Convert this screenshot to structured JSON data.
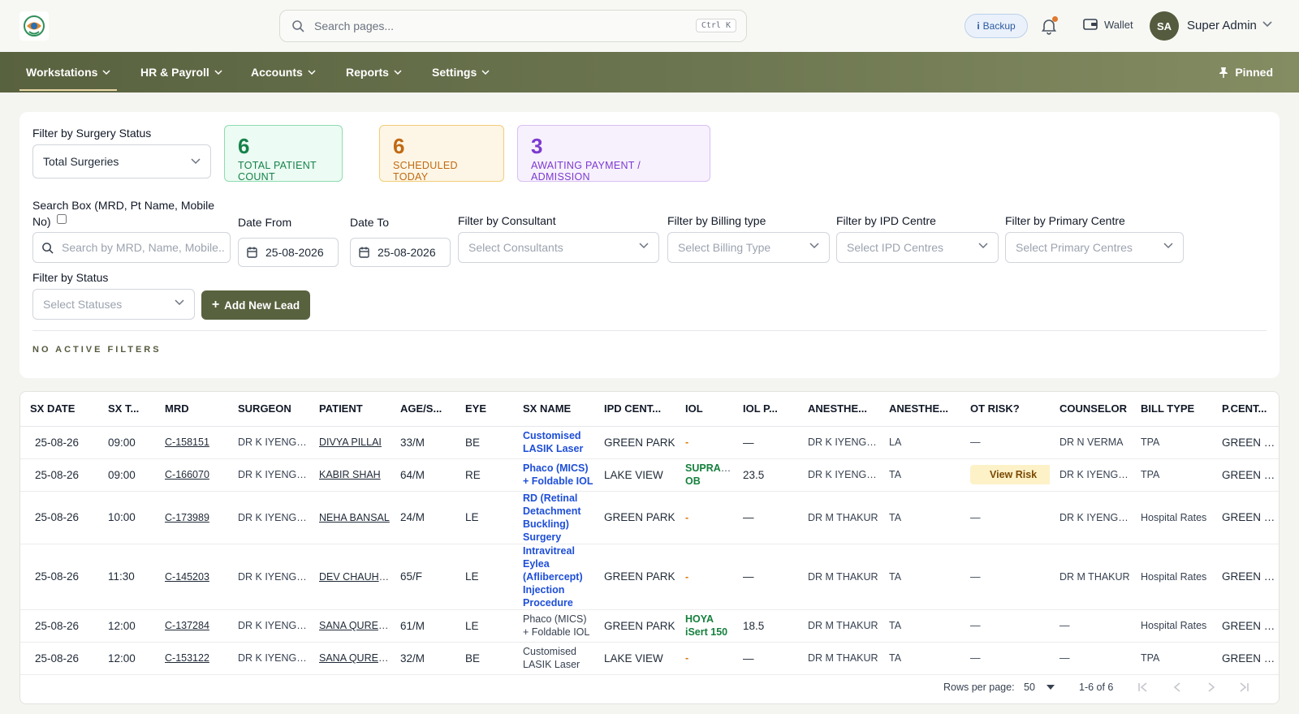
{
  "header": {
    "search_placeholder": "Search pages...",
    "search_shortcut": "Ctrl K",
    "backup_label": "Backup",
    "wallet_label": "Wallet",
    "user_initials": "SA",
    "user_name": "Super Admin"
  },
  "nav": {
    "items": [
      {
        "label": "Workstations",
        "active": true
      },
      {
        "label": "HR & Payroll"
      },
      {
        "label": "Accounts"
      },
      {
        "label": "Reports"
      },
      {
        "label": "Settings"
      }
    ],
    "pinned_label": "Pinned"
  },
  "filters": {
    "surgery_status_label": "Filter by Surgery Status",
    "surgery_status_value": "Total Surgeries",
    "stats": [
      {
        "count": "6",
        "caption": "TOTAL PATIENT COUNT"
      },
      {
        "count": "6",
        "caption": "SCHEDULED TODAY"
      },
      {
        "count": "3",
        "caption": "AWAITING PAYMENT / ADMISSION"
      }
    ],
    "search_label_line1": "Search Box (MRD, Pt Name, Mobile",
    "search_label_line2": "No)",
    "search_placeholder": "Search by MRD, Name, Mobile...",
    "date_from_label": "Date From",
    "date_from_value": "25-08-2026",
    "date_to_label": "Date To",
    "date_to_value": "25-08-2026",
    "consultant_label": "Filter by Consultant",
    "consultant_placeholder": "Select Consultants",
    "billing_label": "Filter by Billing type",
    "billing_placeholder": "Select Billing Type",
    "ipd_label": "Filter by IPD Centre",
    "ipd_placeholder": "Select IPD Centres",
    "primary_label": "Filter by Primary Centre",
    "primary_placeholder": "Select Primary Centres",
    "status_label": "Filter by Status",
    "status_placeholder": "Select Statuses",
    "add_lead_label": "Add New Lead",
    "no_active_filters": "NO ACTIVE FILTERS"
  },
  "table": {
    "columns": [
      "SX DATE",
      "SX T...",
      "MRD",
      "SURGEON",
      "PATIENT",
      "AGE/S...",
      "EYE",
      "SX NAME",
      "IPD CENT...",
      "IOL",
      "IOL P...",
      "ANESTHE...",
      "ANESTHE...",
      "OT RISK?",
      "COUNSELOR",
      "BILL TYPE",
      "P.CENT..."
    ],
    "rows": [
      {
        "date": "25-08-26",
        "time": "09:00",
        "mrd": "C-158151",
        "surgeon": "DR K IYENGAR",
        "patient": "DIVYA PILLAI",
        "age": "33/M",
        "eye": "BE",
        "sx": "Customised LASIK Laser",
        "ipd": "GREEN PARK",
        "iol": "-",
        "iolp": "—",
        "anes1": "DR K IYENGAR",
        "anes2": "LA",
        "risk": "—",
        "counselor": "DR N VERMA",
        "bill": "TPA",
        "pcent": "GREEN PA..."
      },
      {
        "date": "25-08-26",
        "time": "09:00",
        "mrd": "C-166070",
        "surgeon": "DR K IYENGAR",
        "patient": "KABIR SHAH",
        "age": "64/M",
        "eye": "RE",
        "sx": "Phaco (MICS) + Foldable IOL",
        "ipd": "LAKE VIEW",
        "iol": "SUPRAPH OB",
        "iolp": "23.5",
        "anes1": "DR K IYENGAR",
        "anes2": "TA",
        "risk": "View Risk",
        "counselor": "DR K IYENGAR",
        "bill": "TPA",
        "pcent": "GREEN PA..."
      },
      {
        "date": "25-08-26",
        "time": "10:00",
        "mrd": "C-173989",
        "surgeon": "DR K IYENGAR",
        "patient": "NEHA BANSAL",
        "age": "24/M",
        "eye": "LE",
        "sx": "RD (Retinal Detachment Buckling) Surgery",
        "ipd": "GREEN PARK",
        "iol": "-",
        "iolp": "—",
        "anes1": "DR M THAKUR",
        "anes2": "TA",
        "risk": "—",
        "counselor": "DR K IYENGAR",
        "bill": "Hospital Rates",
        "pcent": "GREEN PA..."
      },
      {
        "date": "25-08-26",
        "time": "11:30",
        "mrd": "C-145203",
        "surgeon": "DR K IYENGAR",
        "patient": "DEV CHAUHAN",
        "age": "65/F",
        "eye": "LE",
        "sx": "Intravitreal Eylea (Aflibercept) Injection Procedure",
        "ipd": "GREEN PARK",
        "iol": "-",
        "iolp": "—",
        "anes1": "DR M THAKUR",
        "anes2": "TA",
        "risk": "—",
        "counselor": "DR M THAKUR",
        "bill": "Hospital Rates",
        "pcent": "GREEN PA..."
      },
      {
        "date": "25-08-26",
        "time": "12:00",
        "mrd": "C-137284",
        "surgeon": "DR K IYENGAR",
        "patient": "SANA QURES...",
        "age": "61/M",
        "eye": "LE",
        "sx": "Phaco (MICS) + Foldable IOL",
        "ipd": "GREEN PARK",
        "iol": "HOYA iSert 150",
        "iolp": "18.5",
        "anes1": "DR M THAKUR",
        "anes2": "TA",
        "risk": "—",
        "counselor": "—",
        "bill": "Hospital Rates",
        "pcent": "GREEN PA..."
      },
      {
        "date": "25-08-26",
        "time": "12:00",
        "mrd": "C-153122",
        "surgeon": "DR K IYENGAR",
        "patient": "SANA QURES...",
        "age": "32/M",
        "eye": "BE",
        "sx": "Customised LASIK Laser",
        "ipd": "LAKE VIEW",
        "iol": "-",
        "iolp": "—",
        "anes1": "DR M THAKUR",
        "anes2": "TA",
        "risk": "—",
        "counselor": "—",
        "bill": "TPA",
        "pcent": "GREEN PA..."
      }
    ]
  },
  "pagination": {
    "rows_per_page_label": "Rows per page:",
    "rows_per_page_value": "50",
    "range": "1-6 of 6"
  },
  "colors": {
    "brand_olive": "#59623f",
    "stat_green": "#16824a",
    "stat_amber": "#c16a12",
    "stat_purple": "#7c3ad0",
    "link_blue": "#1d4ed8"
  }
}
